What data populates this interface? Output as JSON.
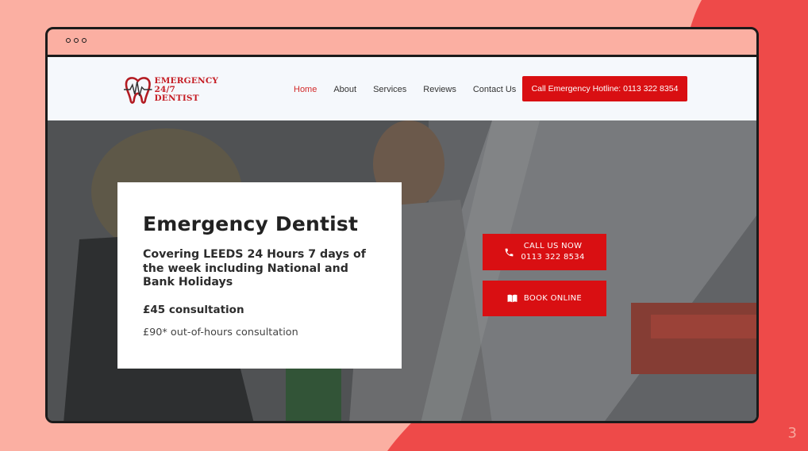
{
  "slide": {
    "number": "3"
  },
  "colors": {
    "background": "#fbafa2",
    "blob": "#ee4a49",
    "brand_red": "#d90f12",
    "header_bg": "#f5f8fc"
  },
  "site": {
    "logo": {
      "line1": "EMERGENCY",
      "line2": "24/7 DENTIST",
      "icon": "tooth-heartbeat-icon"
    },
    "nav": {
      "items": [
        {
          "label": "Home",
          "active": true
        },
        {
          "label": "About",
          "active": false
        },
        {
          "label": "Services",
          "active": false
        },
        {
          "label": "Reviews",
          "active": false
        },
        {
          "label": "Contact Us",
          "active": false
        }
      ],
      "hotline_label": "Call Emergency Hotline: 0113 322 8354"
    },
    "hero": {
      "title": "Emergency Dentist",
      "subtitle": "Covering LEEDS 24 Hours 7 days of the week including National and Bank Holidays",
      "price": "£45 consultation",
      "out_of_hours": "£90* out-of-hours consultation",
      "call": {
        "line1": "CALL US NOW",
        "line2": "0113 322 8534",
        "icon": "phone-icon"
      },
      "book": {
        "label": "BOOK ONLINE",
        "icon": "book-icon"
      }
    }
  }
}
